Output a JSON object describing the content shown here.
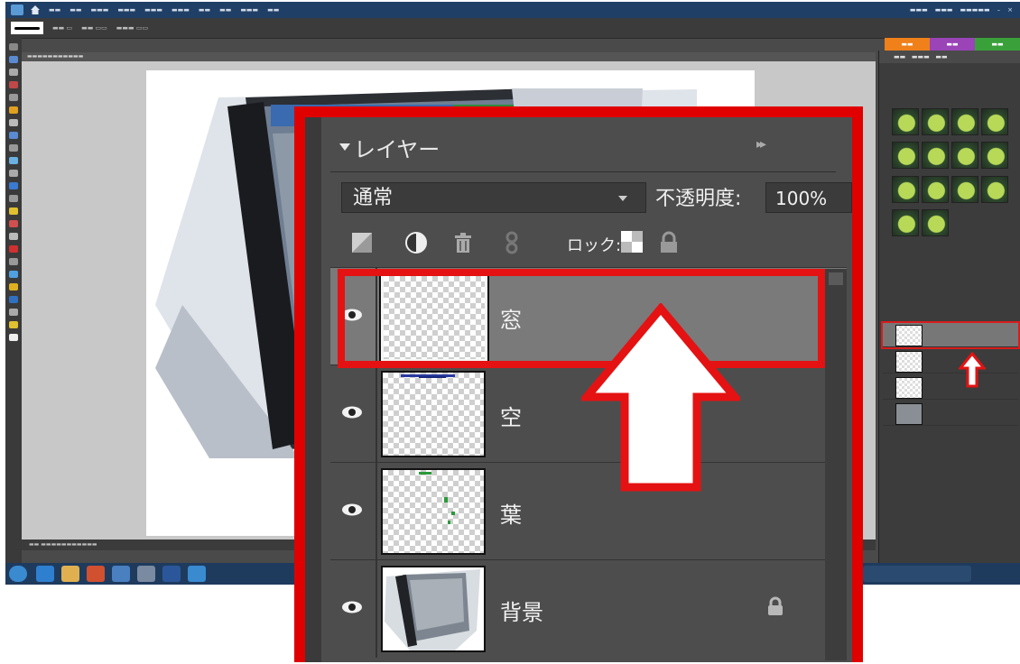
{
  "layers_panel": {
    "title": "レイヤー",
    "more_glyph": "▸▸",
    "blend_mode": "通常",
    "opacity_label": "不透明度:",
    "opacity_value": "100%",
    "lock_label": "ロック:",
    "layers": [
      {
        "name": "窓",
        "visible": true,
        "selected": true,
        "locked": false
      },
      {
        "name": "空",
        "visible": true,
        "selected": false,
        "locked": false
      },
      {
        "name": "葉",
        "visible": true,
        "selected": false,
        "locked": false
      },
      {
        "name": "背景",
        "visible": true,
        "selected": false,
        "locked": true
      }
    ]
  },
  "annotation": {
    "highlight_color": "#e41212",
    "arrow_fill": "#ffffff",
    "arrow_stroke": "#e41212"
  },
  "background_app": {
    "mode_tabs": [
      {
        "color": "#f0801a"
      },
      {
        "color": "#9a44b8"
      },
      {
        "color": "#3aa13a"
      }
    ],
    "menubar_color": "#1f3f66",
    "taskbar_color": "#1e3b5e"
  }
}
